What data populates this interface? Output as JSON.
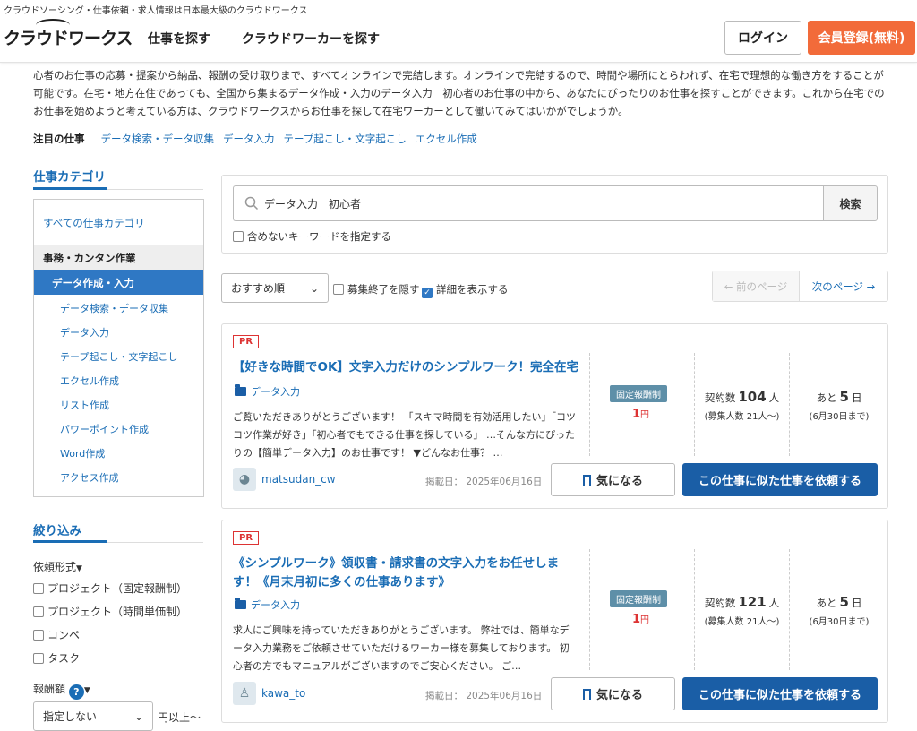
{
  "header": {
    "tagline": "クラウドソーシング・仕事依頼・求人情報は日本最大級のクラウドワークス",
    "logo": "クラウドワークス",
    "nav": [
      "仕事を探す",
      "クラウドワーカーを探す"
    ],
    "login": "ログイン",
    "register": "会員登録(無料)"
  },
  "intro": "心者のお仕事の応募・提案から納品、報酬の受け取りまで、すべてオンラインで完結します。オンラインで完結するので、時間や場所にとらわれず、在宅で理想的な働き方をすることが可能です。在宅・地方在住であっても、全国から集まるデータ作成・入力のデータ入力　初心者のお仕事の中から、あなたにぴったりのお仕事を探すことができます。これから在宅でのお仕事を始めようと考えている方は、クラウドワークスからお仕事を探して在宅ワーカーとして働いてみてはいかがでしょうか。",
  "featured": {
    "label": "注目の仕事",
    "links": [
      "データ検索・データ収集",
      "データ入力",
      "テープ起こし・文字起こし",
      "エクセル作成"
    ]
  },
  "sidebar": {
    "category_title": "仕事カテゴリ",
    "all_categories": "すべての仕事カテゴリ",
    "group": "事務・カンタン作業",
    "active": "データ作成・入力",
    "subs": [
      "データ検索・データ収集",
      "データ入力",
      "テープ起こし・文字起こし",
      "エクセル作成",
      "リスト作成",
      "パワーポイント作成",
      "Word作成",
      "アクセス作成"
    ],
    "filter_title": "絞り込み",
    "type_label": "依頼形式",
    "types": [
      "プロジェクト（固定報酬制）",
      "プロジェクト（時間単価制）",
      "コンペ",
      "タスク"
    ],
    "reward_label": "報酬額",
    "reward_select": "指定しない",
    "reward_suffix": "円以上〜"
  },
  "search": {
    "query": "データ入力　初心者",
    "button": "検索",
    "exclude_label": "含めないキーワードを指定する"
  },
  "sort": {
    "selected": "おすすめ順",
    "hide_closed": "募集終了を隠す",
    "show_details": "詳細を表示する",
    "prev": "← 前のページ",
    "next": "次のページ →"
  },
  "jobs": [
    {
      "pr": "PR",
      "title": "【好きな時間でOK】文字入力だけのシンプルワーク！完全在宅",
      "category": "データ入力",
      "description": "ご覧いただきありがとうございます！ 「スキマ時間を有効活用したい」「コツコツ作業が好き」「初心者でもできる仕事を探している」 …そんな方にぴったりの【簡単データ入力】のお仕事です！ ▼どんなお仕事？ …",
      "pay_type": "固定報酬制",
      "price": "1",
      "price_unit": "円",
      "contracts_label": "契約数",
      "contracts": "104",
      "contracts_unit": "人",
      "recruit": "(募集人数 21人〜)",
      "remaining_label": "あと",
      "remaining": "5",
      "remaining_unit": "日",
      "deadline": "(6月30日まで)",
      "user": "matsudan_cw",
      "posted": "掲載日： 2025年06月16日",
      "watch": "気になる",
      "request": "この仕事に似た仕事を依頼する"
    },
    {
      "pr": "PR",
      "title": "《シンプルワーク》領収書・請求書の文字入力をお任せします！《月末月初に多くの仕事あります》",
      "category": "データ入力",
      "description": "求人にご興味を持っていただきありがとうございます。 弊社では、簡単なデータ入力業務をご依頼させていただけるワーカー様を募集しております。 初心者の方でもマニュアルがございますのでご安心ください。 ご…",
      "pay_type": "固定報酬制",
      "price": "1",
      "price_unit": "円",
      "contracts_label": "契約数",
      "contracts": "121",
      "contracts_unit": "人",
      "recruit": "(募集人数 21人〜)",
      "remaining_label": "あと",
      "remaining": "5",
      "remaining_unit": "日",
      "deadline": "(6月30日まで)",
      "user": "kawa_to",
      "posted": "掲載日： 2025年06月16日",
      "watch": "気になる",
      "request": "この仕事に似た仕事を依頼する"
    }
  ]
}
